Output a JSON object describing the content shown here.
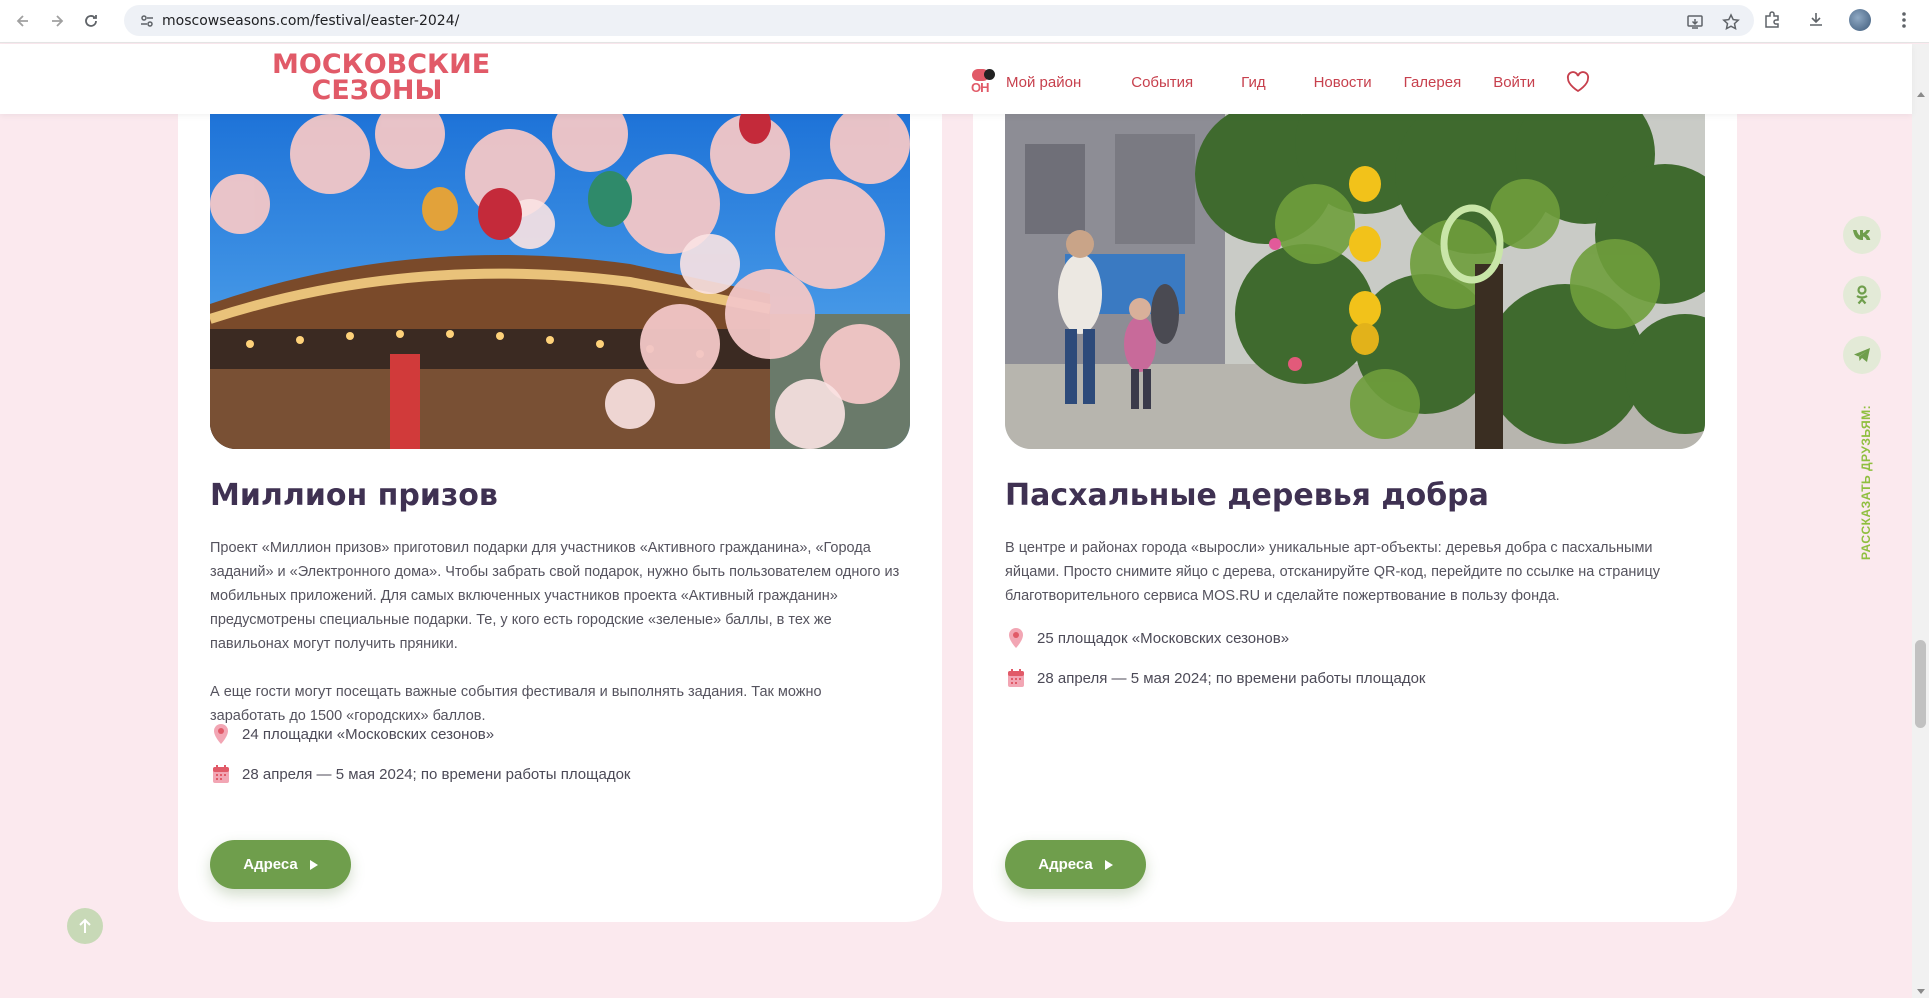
{
  "browser": {
    "url": "moscowseasons.com/festival/easter-2024/"
  },
  "header": {
    "logo_line1": "МОСКОВСКИЕ",
    "logo_line2": "СЕЗОНЫ",
    "moy_badge": "ОН",
    "menu": [
      "Мой район",
      "События",
      "Гид",
      "Новости",
      "Галерея",
      "Войти"
    ]
  },
  "cards": [
    {
      "title": "Миллион призов",
      "paragraphs": [
        "Проект «Миллион призов» приготовил подарки для участников «Активного гражданина», «Города заданий» и «Электронного дома». Чтобы забрать свой подарок, нужно быть пользователем одного из мобильных приложений. Для самых включенных участников проекта «Активный гражданин» предусмотрены специальные подарки. Те, у кого есть городские «зеленые» баллы, в тех же павильонах могут получить пряники.",
        "А еще гости могут посещать важные события фестиваля и выполнять задания. Так можно заработать до 1500 «городских» баллов."
      ],
      "location": "24 площадки «Московских сезонов»",
      "dates": "28 апреля — 5 мая 2024; по времени работы площадок",
      "button": "Адреса"
    },
    {
      "title": "Пасхальные деревья добра",
      "paragraphs": [
        "В центре и районах города «выросли» уникальные арт-объекты: деревья добра с пасхальными яйцами. Просто снимите яйцо с дерева, отсканируйте QR-код, перейдите по ссылке на страницу благотворительного сервиса MOS.RU и сделайте пожертвование в пользу фонда."
      ],
      "location": "25 площадок «Московских сезонов»",
      "dates": "28 апреля — 5 мая 2024; по времени работы площадок",
      "button": "Адреса"
    }
  ],
  "social": {
    "vk": "vk",
    "ok": "ok",
    "telegram": "telegram",
    "share_label": "РАССКАЗАТЬ ДРУЗЬЯМ:"
  },
  "colors": {
    "brand_red": "#e15a68",
    "green": "#6f9e4c",
    "page_bg": "#fbe9ee",
    "title": "#3f3152"
  }
}
